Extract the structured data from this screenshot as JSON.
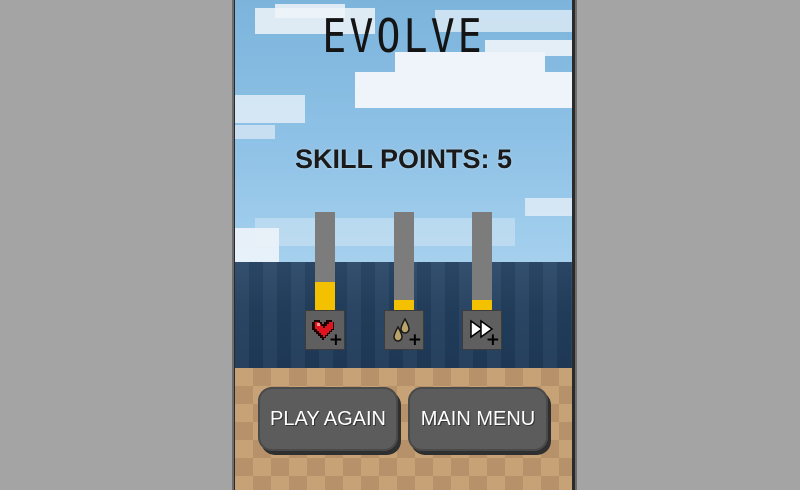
{
  "title": "EVOLVE",
  "skill_points_label": "SKILL POINTS: 5",
  "skills": [
    {
      "icon": "heart-icon",
      "level": 0.3
    },
    {
      "icon": "droplets-icon",
      "level": 0.12
    },
    {
      "icon": "fast-forward-icon",
      "level": 0.12
    }
  ],
  "buttons": {
    "play_again": "PLAY AGAIN",
    "main_menu": "MAIN MENU"
  },
  "colors": {
    "bar_fill": "#f3c100",
    "bar_track": "#7c7c7c",
    "button_bg": "#5c5c5c",
    "heart": "#e0141e"
  }
}
